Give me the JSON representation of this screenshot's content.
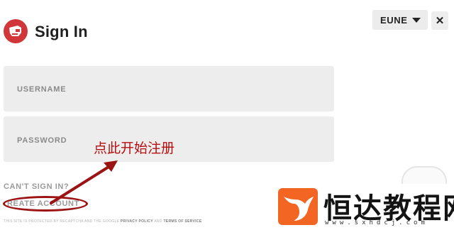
{
  "header": {
    "title": "Sign In"
  },
  "region": {
    "value": "EUNE"
  },
  "form": {
    "username_label": "USERNAME",
    "password_label": "PASSWORD"
  },
  "links": {
    "cant_sign_in": "CAN'T SIGN IN?",
    "create_account": "REATE ACCOUNT"
  },
  "annotation": {
    "text": "点此开始注册",
    "color": "#b40f0f"
  },
  "footer": {
    "notice_prefix": "THIS SITE IS PROTECTED BY RECAPTCHA AND THE GOOGLE",
    "privacy_policy": "PRIVACY POLICY",
    "and": "AND",
    "terms_of_service": "TERMS OF SERVICE"
  },
  "watermark": {
    "brand": "恒达教程网",
    "url": "www.sxhdcj.com"
  },
  "colors": {
    "brand_red": "#d13639",
    "annotation_red": "#9b1313",
    "watermark_orange": "#f26522"
  },
  "icons": {
    "logo": "riot-fist-icon",
    "region_caret": "caret-down-icon",
    "close": "close-icon",
    "next": "arrow-right-icon",
    "watermark_logo": "whale-tail-icon"
  }
}
